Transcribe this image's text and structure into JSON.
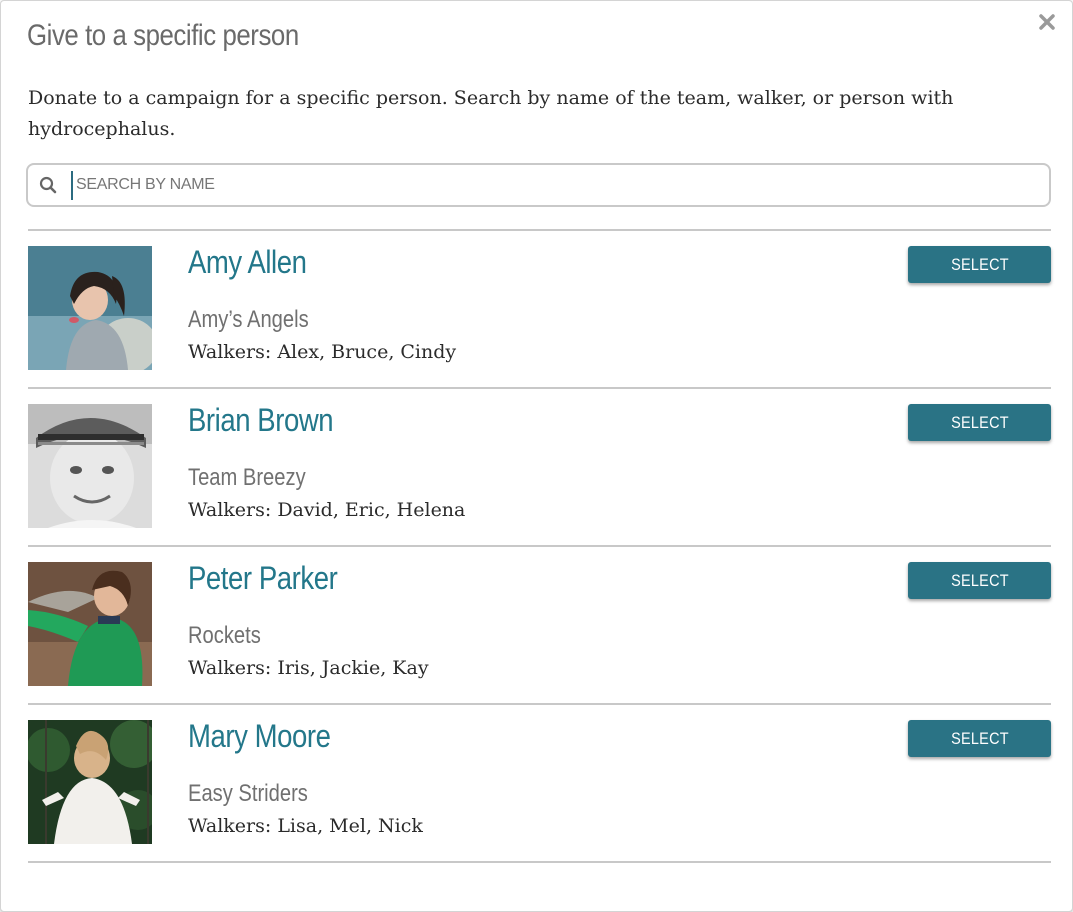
{
  "dialog": {
    "title": "Give to a specific person",
    "description": "Donate to a campaign for a specific person. Search by name of the team, walker, or person with hydrocephalus.",
    "close_icon": "close-icon",
    "search": {
      "placeholder": "SEARCH BY NAME",
      "value": "",
      "icon": "search-icon"
    },
    "select_label": "SELECT"
  },
  "people": [
    {
      "name": "Amy Allen",
      "team": "Amy’s Angels",
      "walkers": "Walkers: Alex, Bruce, Cindy"
    },
    {
      "name": "Brian Brown",
      "team": "Team Breezy",
      "walkers": "Walkers: David, Eric, Helena"
    },
    {
      "name": "Peter Parker",
      "team": "Rockets",
      "walkers": "Walkers: Iris, Jackie, Kay"
    },
    {
      "name": "Mary Moore",
      "team": "Easy Striders",
      "walkers": "Walkers: Lisa, Mel, Nick"
    }
  ],
  "colors": {
    "accent": "#23778a",
    "button": "#2a7385",
    "title_gray": "#6a6a6a",
    "divider": "#c8c8c8"
  }
}
